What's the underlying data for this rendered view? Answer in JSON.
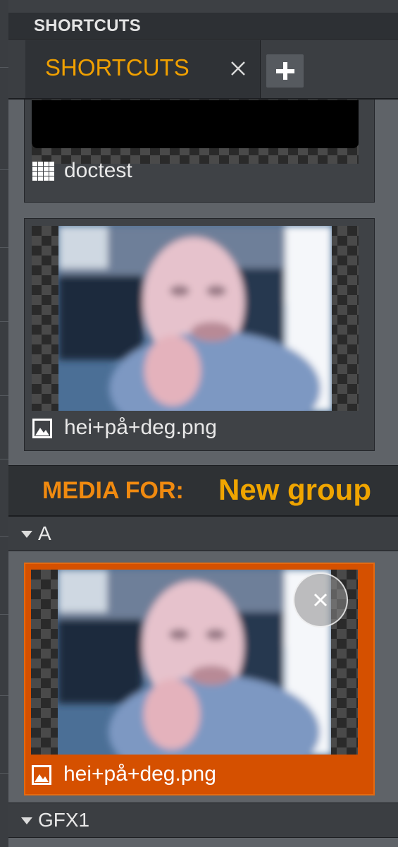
{
  "panel": {
    "title": "SHORTCUTS",
    "tab": {
      "label": "SHORTCUTS",
      "close_icon": "close-icon"
    },
    "add_tab_icon": "plus-icon"
  },
  "shortcuts": [
    {
      "label": "doctest",
      "icon": "grid-icon",
      "thumbnail": "black"
    },
    {
      "label": "hei+på+deg.png",
      "icon": "image-icon",
      "thumbnail": "photo"
    }
  ],
  "media": {
    "label": "MEDIA FOR:",
    "group_name": "New group",
    "groups": [
      {
        "name": "A",
        "items": [
          {
            "label": "hei+på+deg.png",
            "icon": "image-icon",
            "selected": true,
            "remove_icon": "close-circle-icon"
          }
        ]
      },
      {
        "name": "GFX1",
        "items": []
      }
    ]
  },
  "colors": {
    "accent": "#f0a000",
    "media_label": "#f08a10",
    "selected": "#d55000"
  }
}
